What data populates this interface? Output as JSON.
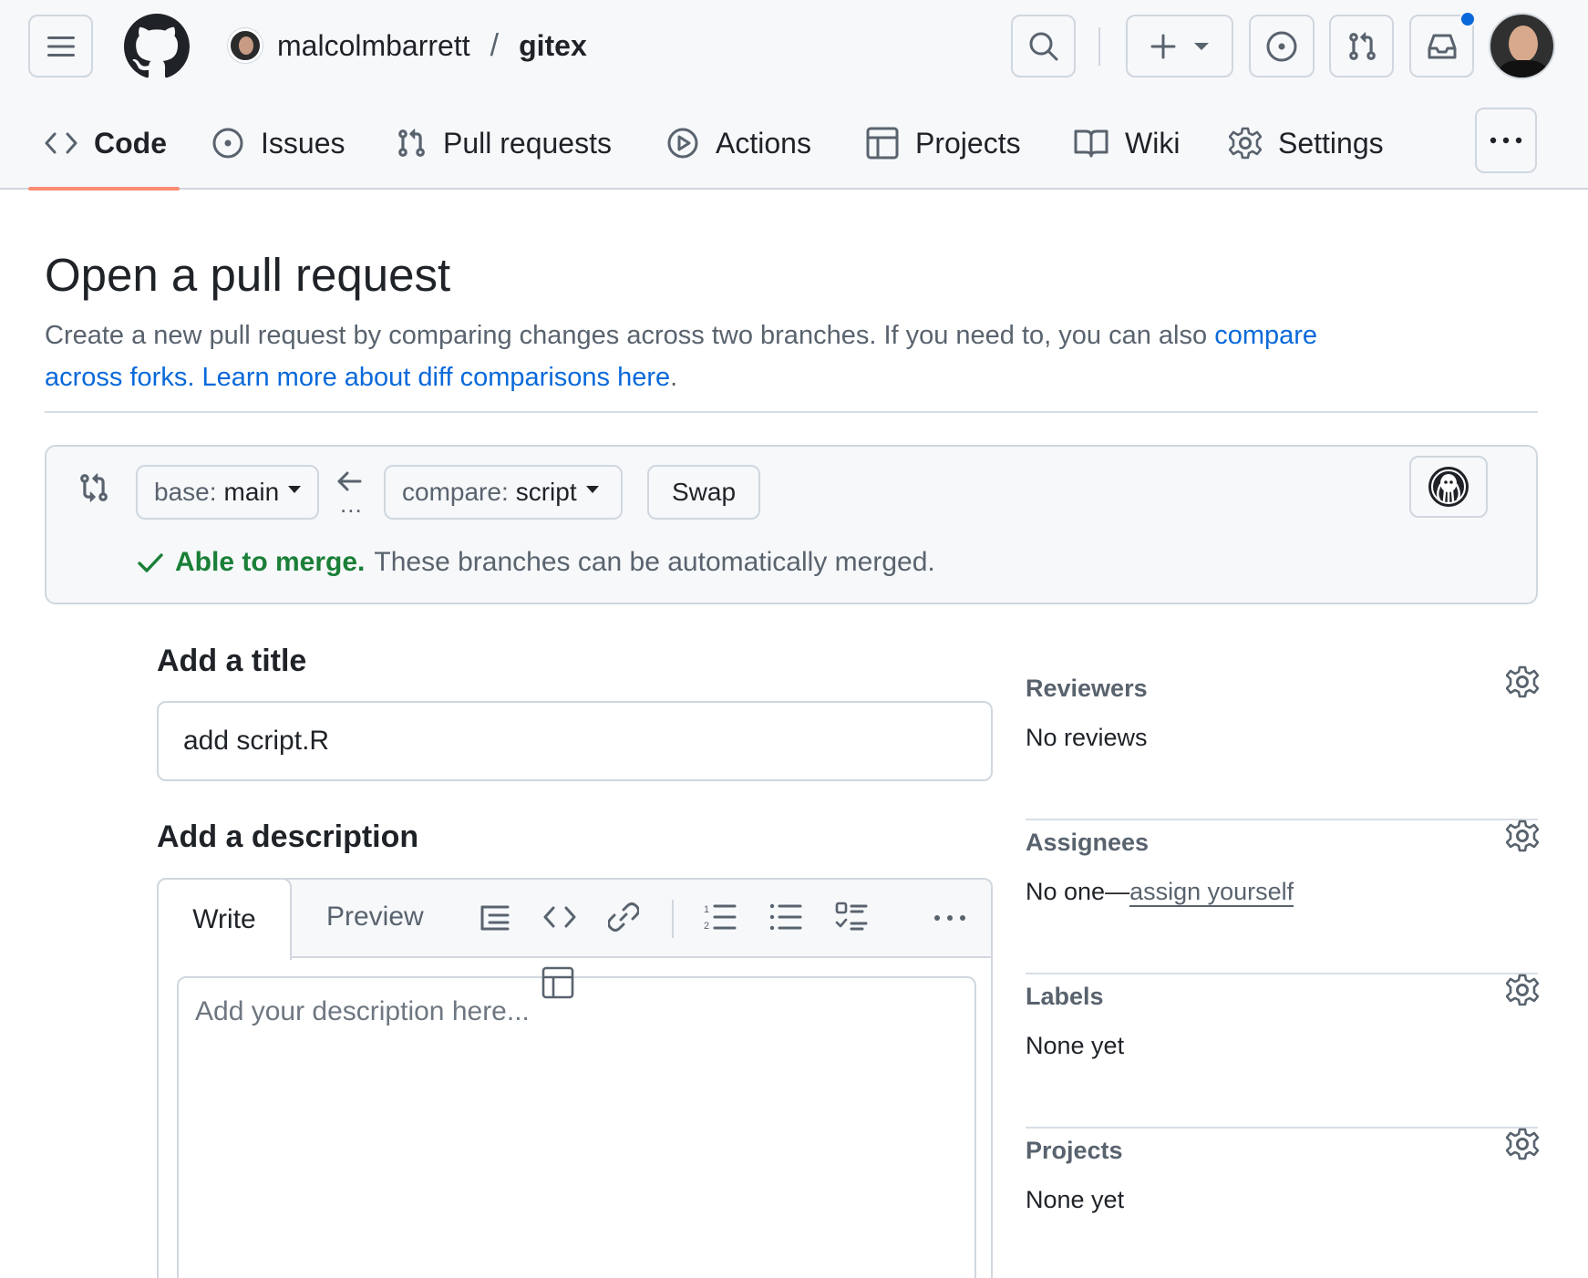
{
  "header": {
    "owner": "malcolmbarrett",
    "separator": "/",
    "repo": "gitex"
  },
  "nav": {
    "tabs": [
      {
        "label": "Code",
        "icon": "code-icon",
        "active": true
      },
      {
        "label": "Issues",
        "icon": "issue-opened-icon"
      },
      {
        "label": "Pull requests",
        "icon": "git-pull-request-icon"
      },
      {
        "label": "Actions",
        "icon": "play-icon"
      },
      {
        "label": "Projects",
        "icon": "table-icon"
      },
      {
        "label": "Wiki",
        "icon": "book-icon"
      },
      {
        "label": "Settings",
        "icon": "gear-icon"
      }
    ]
  },
  "page": {
    "title": "Open a pull request",
    "description": "Create a new pull request by comparing changes across two branches. If you need to, you can also",
    "link_forks": "compare across forks.",
    "link_learn": "Learn more about diff comparisons here",
    "period": "."
  },
  "compare": {
    "base_prefix": "base:",
    "base_branch": "main",
    "compare_prefix": "compare:",
    "compare_branch": "script",
    "swap_label": "Swap",
    "dots": "...",
    "merge_ok": "Able to merge.",
    "merge_text": "These branches can be automatically merged."
  },
  "form": {
    "title_heading": "Add a title",
    "title_value": "add script.R",
    "desc_heading": "Add a description",
    "tab_write": "Write",
    "tab_preview": "Preview",
    "desc_placeholder": "Add your description here..."
  },
  "sidebar": {
    "reviewers": {
      "heading": "Reviewers",
      "value": "No reviews"
    },
    "assignees": {
      "heading": "Assignees",
      "value": "No one—",
      "link": "assign yourself"
    },
    "labels": {
      "heading": "Labels",
      "value": "None yet"
    },
    "projects": {
      "heading": "Projects",
      "value": "None yet"
    }
  },
  "colors": {
    "accent_link": "#0969da",
    "success": "#1a7f37",
    "active_tab_underline": "#fd8c73",
    "notification": "#0969da"
  }
}
